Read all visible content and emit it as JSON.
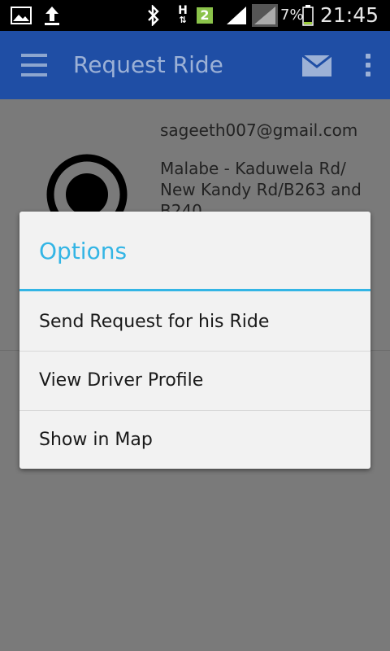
{
  "status_bar": {
    "time": "21:45",
    "battery_percent": "7%",
    "notification_badge": "2",
    "network_type": "H"
  },
  "action_bar": {
    "title": "Request Ride"
  },
  "profile": {
    "email": "sageeth007@gmail.com",
    "address": "Malabe - Kaduwela Rd/ New Kandy Rd/B263 and B240"
  },
  "dialog": {
    "title": "Options",
    "options": [
      "Send Request for his Ride",
      "View Driver Profile",
      "Show in Map"
    ]
  },
  "colors": {
    "action_bar": "#1f4ea5",
    "dialog_accent": "#33b5e5",
    "dialog_bg": "#f2f2f2"
  }
}
